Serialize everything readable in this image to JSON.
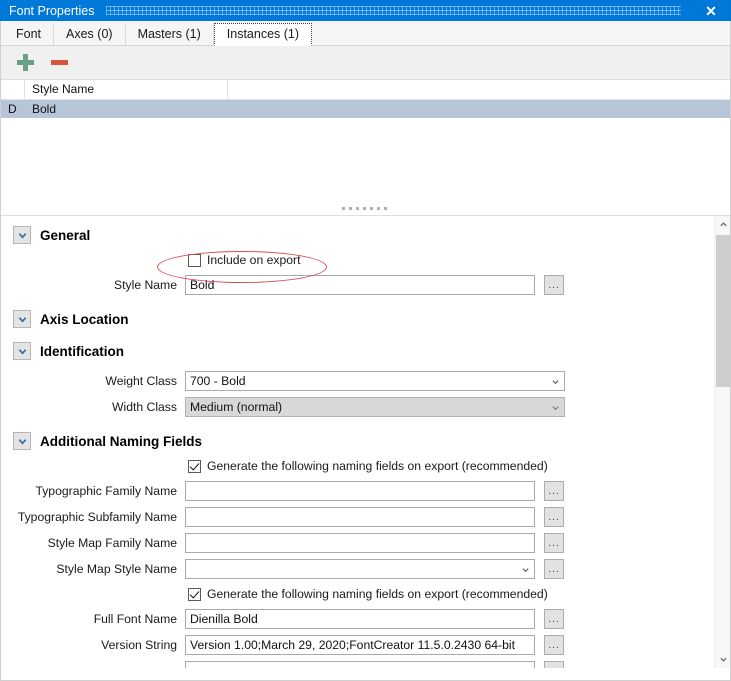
{
  "window": {
    "title": "Font Properties",
    "close_label": "✕"
  },
  "tabs": [
    {
      "label": "Font",
      "active": false
    },
    {
      "label": "Axes (0)",
      "active": false
    },
    {
      "label": "Masters (1)",
      "active": false
    },
    {
      "label": "Instances (1)",
      "active": true
    }
  ],
  "toolbar": {
    "add_icon": "plus-icon",
    "remove_icon": "minus-icon",
    "add_color": "#6aa084",
    "remove_color": "#d4553a"
  },
  "instance_list": {
    "columns": [
      "",
      "Style Name",
      ""
    ],
    "rows": [
      {
        "flag": "D",
        "style_name": "Bold",
        "selected": true
      }
    ],
    "selection_color": "#b6c5d8"
  },
  "properties": {
    "sections": [
      {
        "title": "General",
        "expanded": true
      },
      {
        "title": "Axis Location",
        "expanded": true
      },
      {
        "title": "Identification",
        "expanded": true
      },
      {
        "title": "Additional Naming Fields",
        "expanded": true
      }
    ],
    "general": {
      "include_on_export": {
        "label": "Include on export",
        "checked": false,
        "highlighted": true
      },
      "style_name": {
        "label": "Style Name",
        "value": "Bold",
        "browse": "..."
      }
    },
    "identification": {
      "weight_class": {
        "label": "Weight Class",
        "value": "700 - Bold",
        "disabled": false
      },
      "width_class": {
        "label": "Width Class",
        "value": "Medium (normal)",
        "disabled": true
      }
    },
    "additional_naming": {
      "generate_check_1": {
        "label": "Generate the following naming fields on export (recommended)",
        "checked": true
      },
      "typographic_family_name": {
        "label": "Typographic Family Name",
        "value": "",
        "browse": "..."
      },
      "typographic_subfamily_name": {
        "label": "Typographic Subfamily Name",
        "value": "",
        "browse": "..."
      },
      "style_map_family_name": {
        "label": "Style Map Family Name",
        "value": "",
        "browse": "..."
      },
      "style_map_style_name": {
        "label": "Style Map Style Name",
        "value": "",
        "browse": "..."
      },
      "generate_check_2": {
        "label": "Generate the following naming fields on export (recommended)",
        "checked": true
      },
      "full_font_name": {
        "label": "Full Font Name",
        "value": "Dienilla Bold",
        "browse": "..."
      },
      "version_string": {
        "label": "Version String",
        "value": "Version 1.00;March 29, 2020;FontCreator 11.5.0.2430 64-bit",
        "browse": "..."
      },
      "next_field": {
        "label": "",
        "value": "",
        "browse": "..."
      }
    }
  },
  "scrollbar": {
    "up_arrow": "chevron-up-icon",
    "down_arrow": "chevron-down-icon"
  },
  "colors": {
    "titlebar": "#0078d7",
    "annotation": "#d94b50",
    "accent_chevron": "#3a6ea5"
  }
}
